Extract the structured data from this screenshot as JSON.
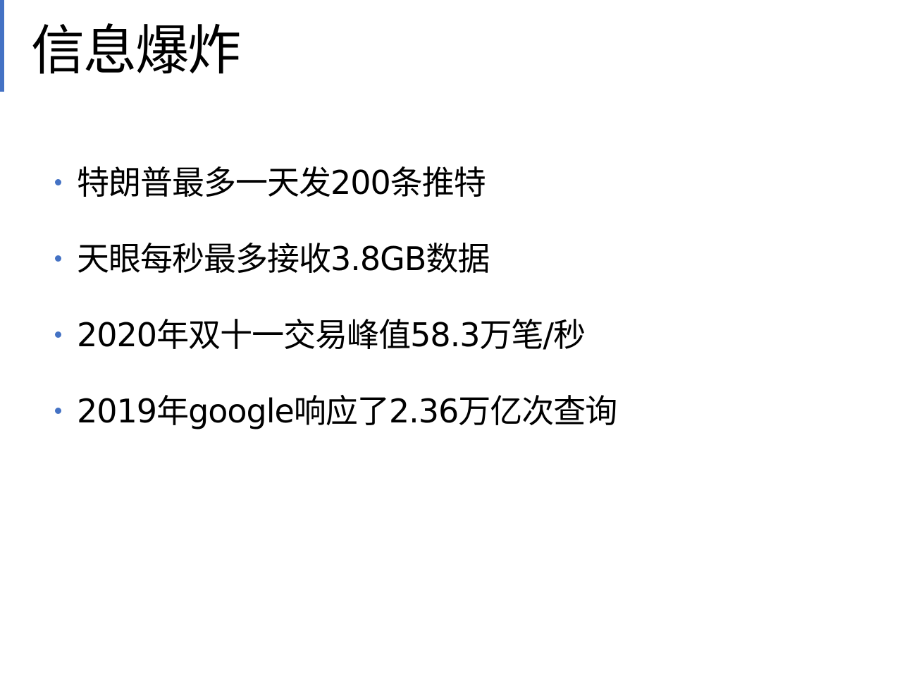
{
  "slide": {
    "title": "信息爆炸",
    "accent_color": "#4472c4",
    "bullet_color": "#4472c4",
    "bullets": [
      {
        "text": "特朗普最多一天发200条推特"
      },
      {
        "text": "天眼每秒最多接收3.8GB数据"
      },
      {
        "text": "2020年双十一交易峰值58.3万笔/秒"
      },
      {
        "text": "2019年google响应了2.36万亿次查询"
      }
    ]
  }
}
